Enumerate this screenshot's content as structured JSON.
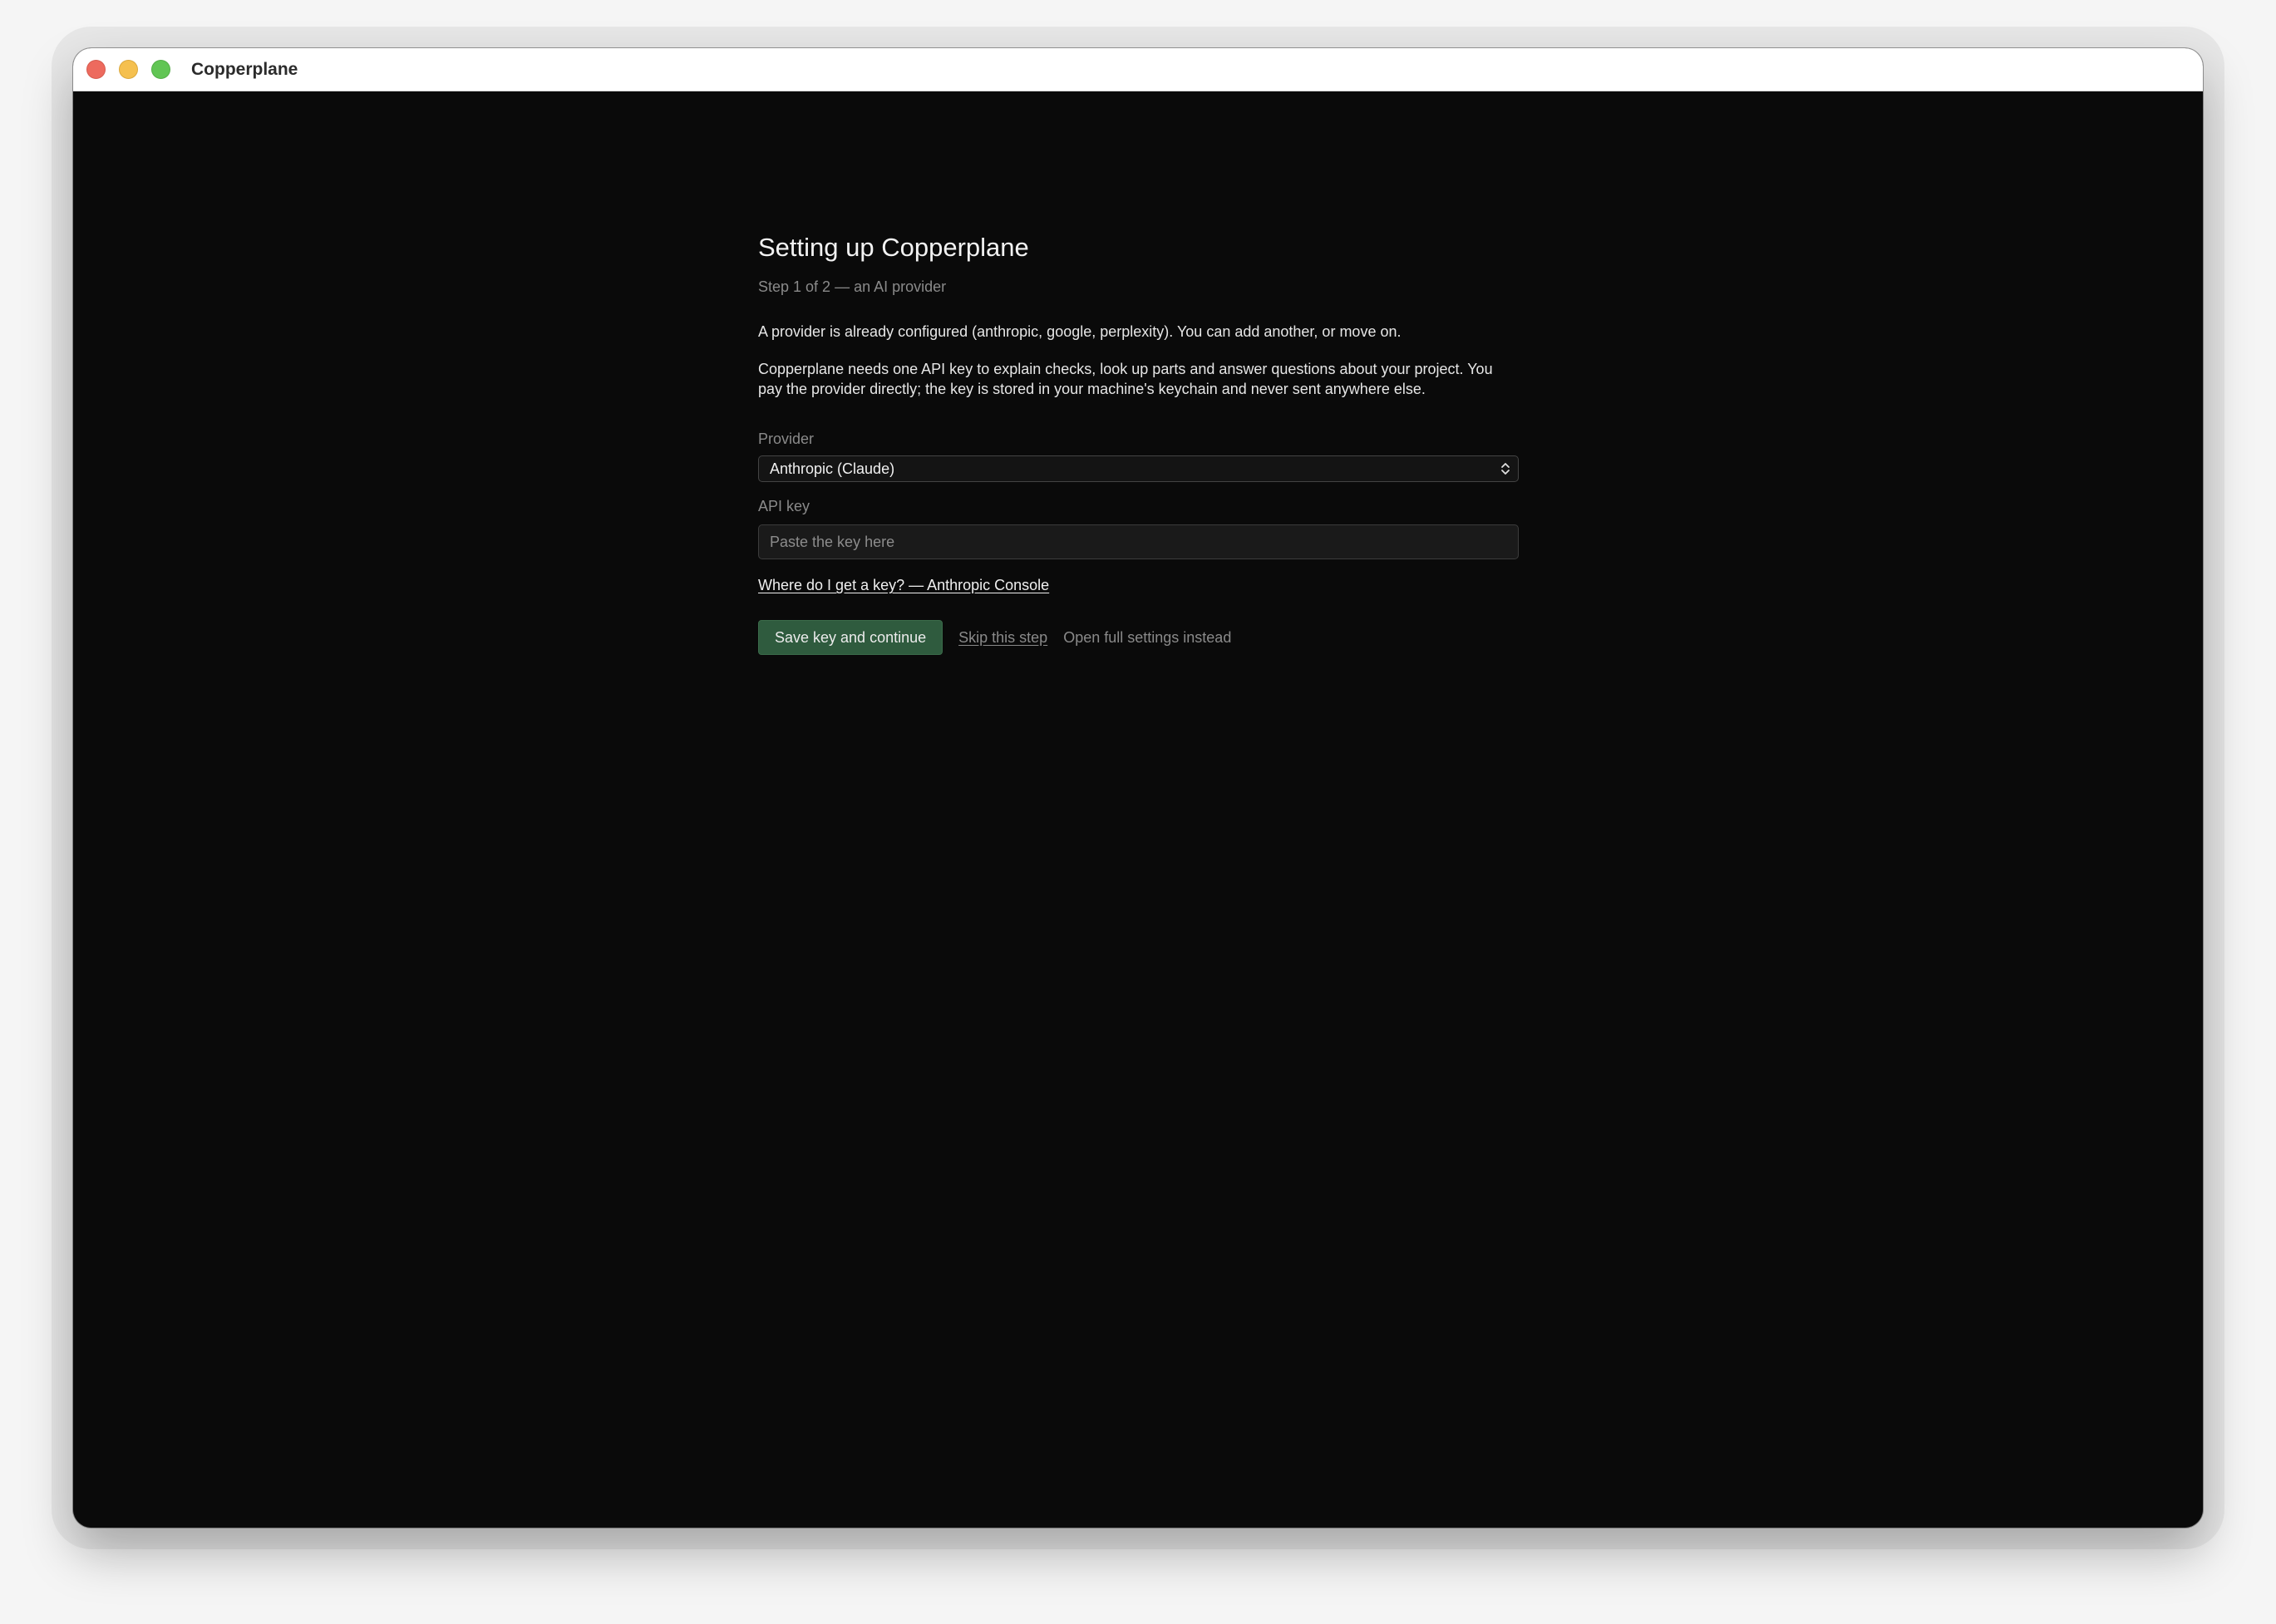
{
  "window": {
    "title": "Copperplane"
  },
  "setup": {
    "heading": "Setting up Copperplane",
    "step": "Step 1 of 2 — an AI provider",
    "notice": "A provider is already configured (anthropic, google, perplexity). You can add another, or move on.",
    "description": "Copperplane needs one API key to explain checks, look up parts and answer questions about your project. You pay the provider directly; the key is stored in your machine's keychain and never sent anywhere else.",
    "provider_label": "Provider",
    "provider_value": "Anthropic (Claude)",
    "api_key_label": "API key",
    "api_key_placeholder": "Paste the key here",
    "api_key_value": "",
    "help_link": "Where do I get a key? — Anthropic Console",
    "save_button": "Save key and continue",
    "skip_button": "Skip this step",
    "settings_button": "Open full settings instead"
  },
  "icons": {
    "traffic_lights": [
      "close-icon",
      "minimize-icon",
      "maximize-icon"
    ],
    "select_arrow": "chevron-updown-icon"
  },
  "colors": {
    "background": "#0a0a0a",
    "primary_button": "#2f5b3e",
    "close": "#ed6a5e",
    "minimize": "#f5c04f",
    "maximize": "#61c554"
  }
}
